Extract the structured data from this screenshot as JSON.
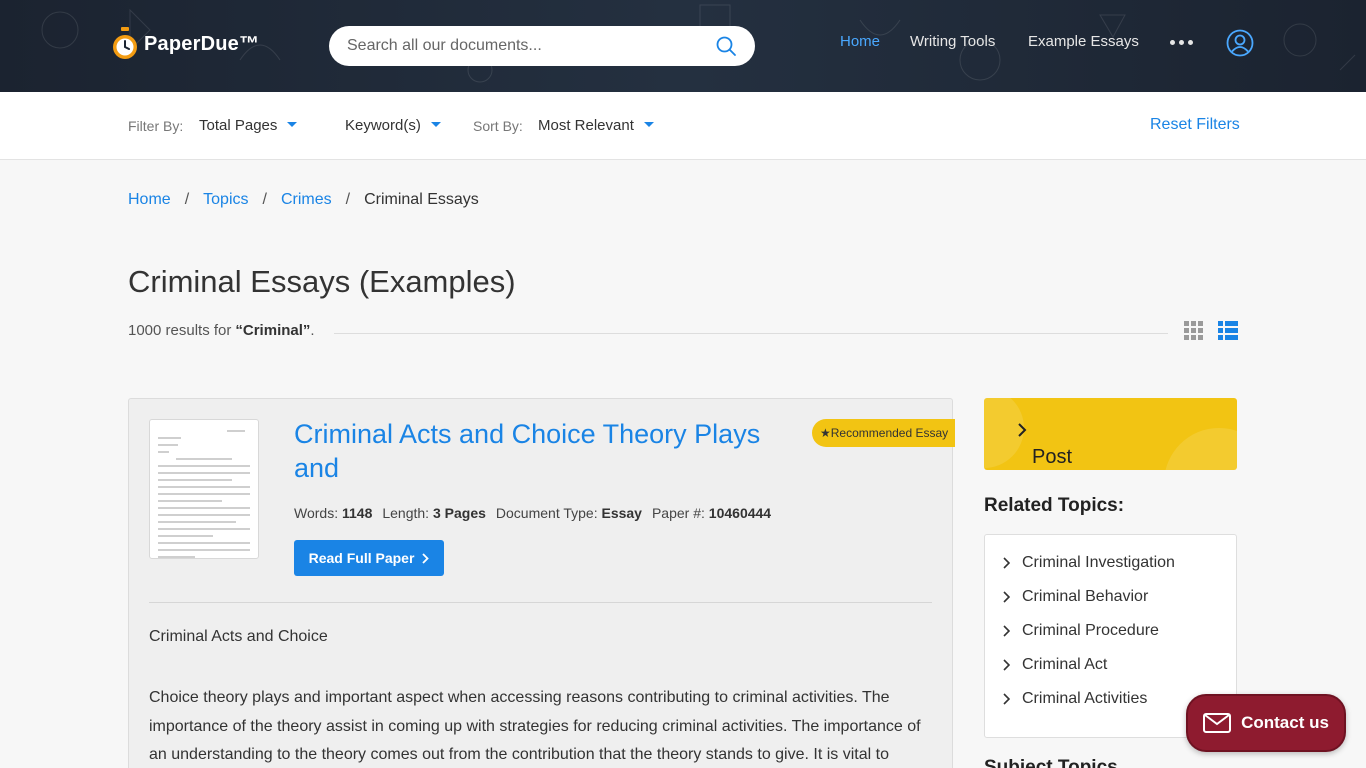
{
  "header": {
    "logo_text": "PaperDue™",
    "search_placeholder": "Search all our documents...",
    "nav": [
      {
        "label": "Home",
        "active": true
      },
      {
        "label": "Writing Tools",
        "active": false
      },
      {
        "label": "Example Essays",
        "active": false
      }
    ],
    "accent_color": "#4aa8ff"
  },
  "filters": {
    "filter_label": "Filter By:",
    "total_pages": "Total Pages",
    "keywords": "Keyword(s)",
    "sort_label": "Sort By:",
    "sort_value": "Most Relevant",
    "reset": "Reset Filters"
  },
  "breadcrumb": {
    "items": [
      "Home",
      "Topics",
      "Crimes"
    ],
    "current": "Criminal Essays",
    "sep": "/"
  },
  "page": {
    "title": "Criminal Essays (Examples)",
    "results_prefix": "1000 results for",
    "results_query": "“Criminal”",
    "results_suffix": "."
  },
  "card": {
    "title": "Criminal Acts and Choice Theory Plays and",
    "badge": "★Recommended Essay",
    "meta": {
      "words_label": "Words:",
      "words": "1148",
      "length_label": "Length:",
      "length": "3 Pages",
      "type_label": "Document Type:",
      "type": "Essay",
      "paper_label": "Paper #:",
      "paper": "10460444"
    },
    "read_button": "Read Full Paper",
    "excerpt_heading": "Criminal Acts and Choice",
    "excerpt": "Choice theory plays and important aspect when accessing reasons contributing to criminal activities. The importance of the theory assist in coming up with strategies for reducing criminal activities. The importance of an understanding to the theory comes out from the contribution that the theory stands to give. It is vital to"
  },
  "sidebar": {
    "post_help": "Post Homework Help",
    "related_title": "Related Topics:",
    "related": [
      "Criminal Investigation",
      "Criminal Behavior",
      "Criminal Procedure",
      "Criminal Act",
      "Criminal Activities"
    ],
    "subjects_title": "Subject Topics"
  },
  "contact": {
    "label": "Contact us",
    "color": "#8e1b2f"
  },
  "icons": [
    "stopwatch-logo-icon",
    "search-icon",
    "more-dots-icon",
    "user-icon",
    "grid-view-icon",
    "list-view-icon",
    "chevron-right-icon",
    "envelope-icon"
  ]
}
